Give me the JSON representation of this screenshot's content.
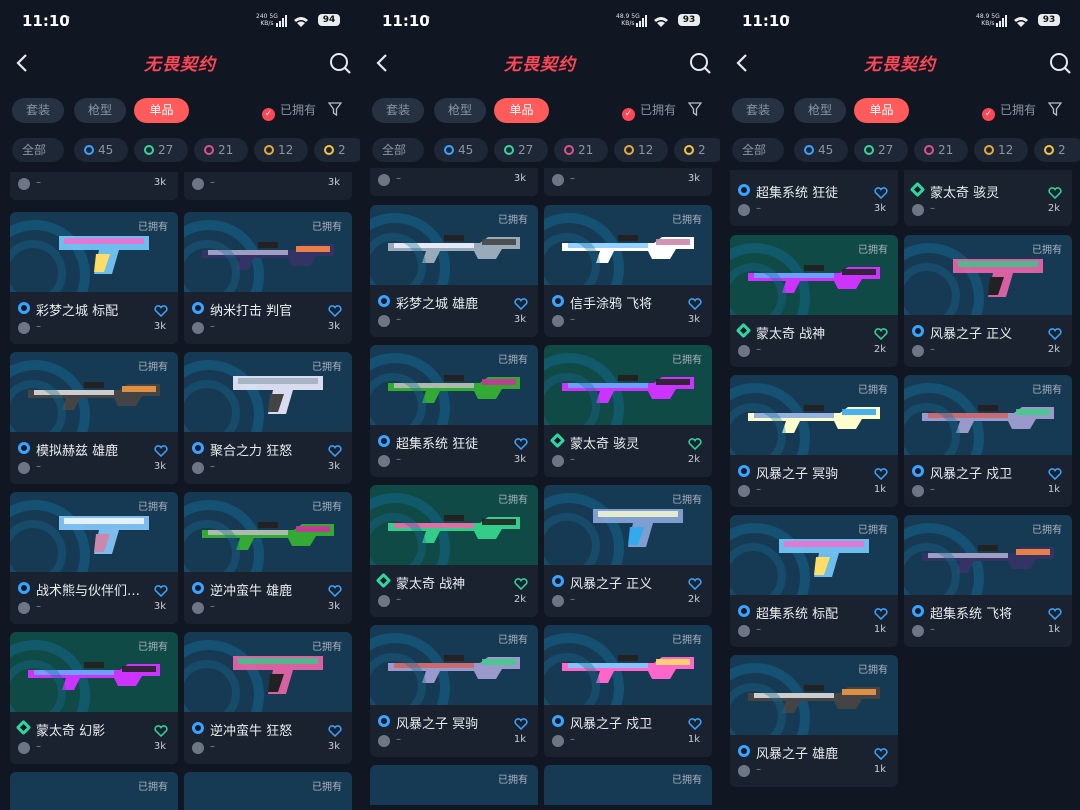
{
  "status": {
    "time": "11:10",
    "dot": "•"
  },
  "header": {
    "logo": "无畏契约"
  },
  "tabs": [
    "套装",
    "枪型",
    "单品"
  ],
  "owned_filter": "已拥有",
  "chips": [
    {
      "label": "全部",
      "color": ""
    },
    {
      "label": "45",
      "color": "#3aa3ff"
    },
    {
      "label": "27",
      "color": "#2fd6a0"
    },
    {
      "label": "21",
      "color": "#e0508c"
    },
    {
      "label": "12",
      "color": "#e6a93a"
    },
    {
      "label": "2",
      "color": "#f5c242"
    }
  ],
  "owned_tag": "已拥有",
  "dash": "–",
  "panels": [
    {
      "net": "240",
      "net2": "5G",
      "net3": "KB/s",
      "battery": "94",
      "top": {
        "left": "3k",
        "right": "3k"
      },
      "cards": [
        {
          "name": "彩梦之城 标配",
          "price": "3k",
          "rarity": "b",
          "teal": false
        },
        {
          "name": "纳米打击 判官",
          "price": "3k",
          "rarity": "b",
          "teal": false
        },
        {
          "name": "模拟赫兹 雄鹿",
          "price": "3k",
          "rarity": "b",
          "teal": false
        },
        {
          "name": "聚合之力 狂怒",
          "price": "3k",
          "rarity": "b",
          "teal": false
        },
        {
          "name": "战术熊与伙伴们…",
          "price": "3k",
          "rarity": "b",
          "teal": false
        },
        {
          "name": "逆冲蛮牛 雄鹿",
          "price": "3k",
          "rarity": "b",
          "teal": false
        },
        {
          "name": "蒙太奇 幻影",
          "price": "3k",
          "rarity": "g",
          "teal": true
        },
        {
          "name": "逆冲蛮牛 狂怒",
          "price": "3k",
          "rarity": "b",
          "teal": false
        }
      ]
    },
    {
      "net": "48.9",
      "net2": "5G",
      "net3": "KB/s",
      "battery": "93",
      "top": {
        "left": "3k",
        "right": "3k"
      },
      "cards": [
        {
          "name": "彩梦之城 雄鹿",
          "price": "3k",
          "rarity": "b",
          "teal": false
        },
        {
          "name": "信手涂鸦 飞将",
          "price": "3k",
          "rarity": "b",
          "teal": false
        },
        {
          "name": "超集系统 狂徒",
          "price": "3k",
          "rarity": "b",
          "teal": false
        },
        {
          "name": "蒙太奇 骇灵",
          "price": "2k",
          "rarity": "g",
          "teal": true
        },
        {
          "name": "蒙太奇 战神",
          "price": "2k",
          "rarity": "g",
          "teal": true
        },
        {
          "name": "风暴之子 正义",
          "price": "2k",
          "rarity": "b",
          "teal": false
        },
        {
          "name": "风暴之子 冥驹",
          "price": "1k",
          "rarity": "b",
          "teal": false
        },
        {
          "name": "风暴之子 戍卫",
          "price": "1k",
          "rarity": "b",
          "teal": false
        }
      ]
    },
    {
      "net": "48.9",
      "net2": "5G",
      "net3": "KB/s",
      "battery": "93",
      "topcards": [
        {
          "name": "超集系统 狂徒",
          "price": "3k",
          "rarity": "b"
        },
        {
          "name": "蒙太奇 骇灵",
          "price": "2k",
          "rarity": "g"
        }
      ],
      "cards": [
        {
          "name": "蒙太奇 战神",
          "price": "2k",
          "rarity": "g",
          "teal": true
        },
        {
          "name": "风暴之子 正义",
          "price": "2k",
          "rarity": "b",
          "teal": false
        },
        {
          "name": "风暴之子 冥驹",
          "price": "1k",
          "rarity": "b",
          "teal": false
        },
        {
          "name": "风暴之子 戍卫",
          "price": "1k",
          "rarity": "b",
          "teal": false
        },
        {
          "name": "超集系统 标配",
          "price": "1k",
          "rarity": "b",
          "teal": false
        },
        {
          "name": "超集系统 飞将",
          "price": "1k",
          "rarity": "b",
          "teal": false
        },
        {
          "name": "风暴之子 雄鹿",
          "price": "1k",
          "rarity": "b",
          "teal": false
        }
      ]
    }
  ]
}
